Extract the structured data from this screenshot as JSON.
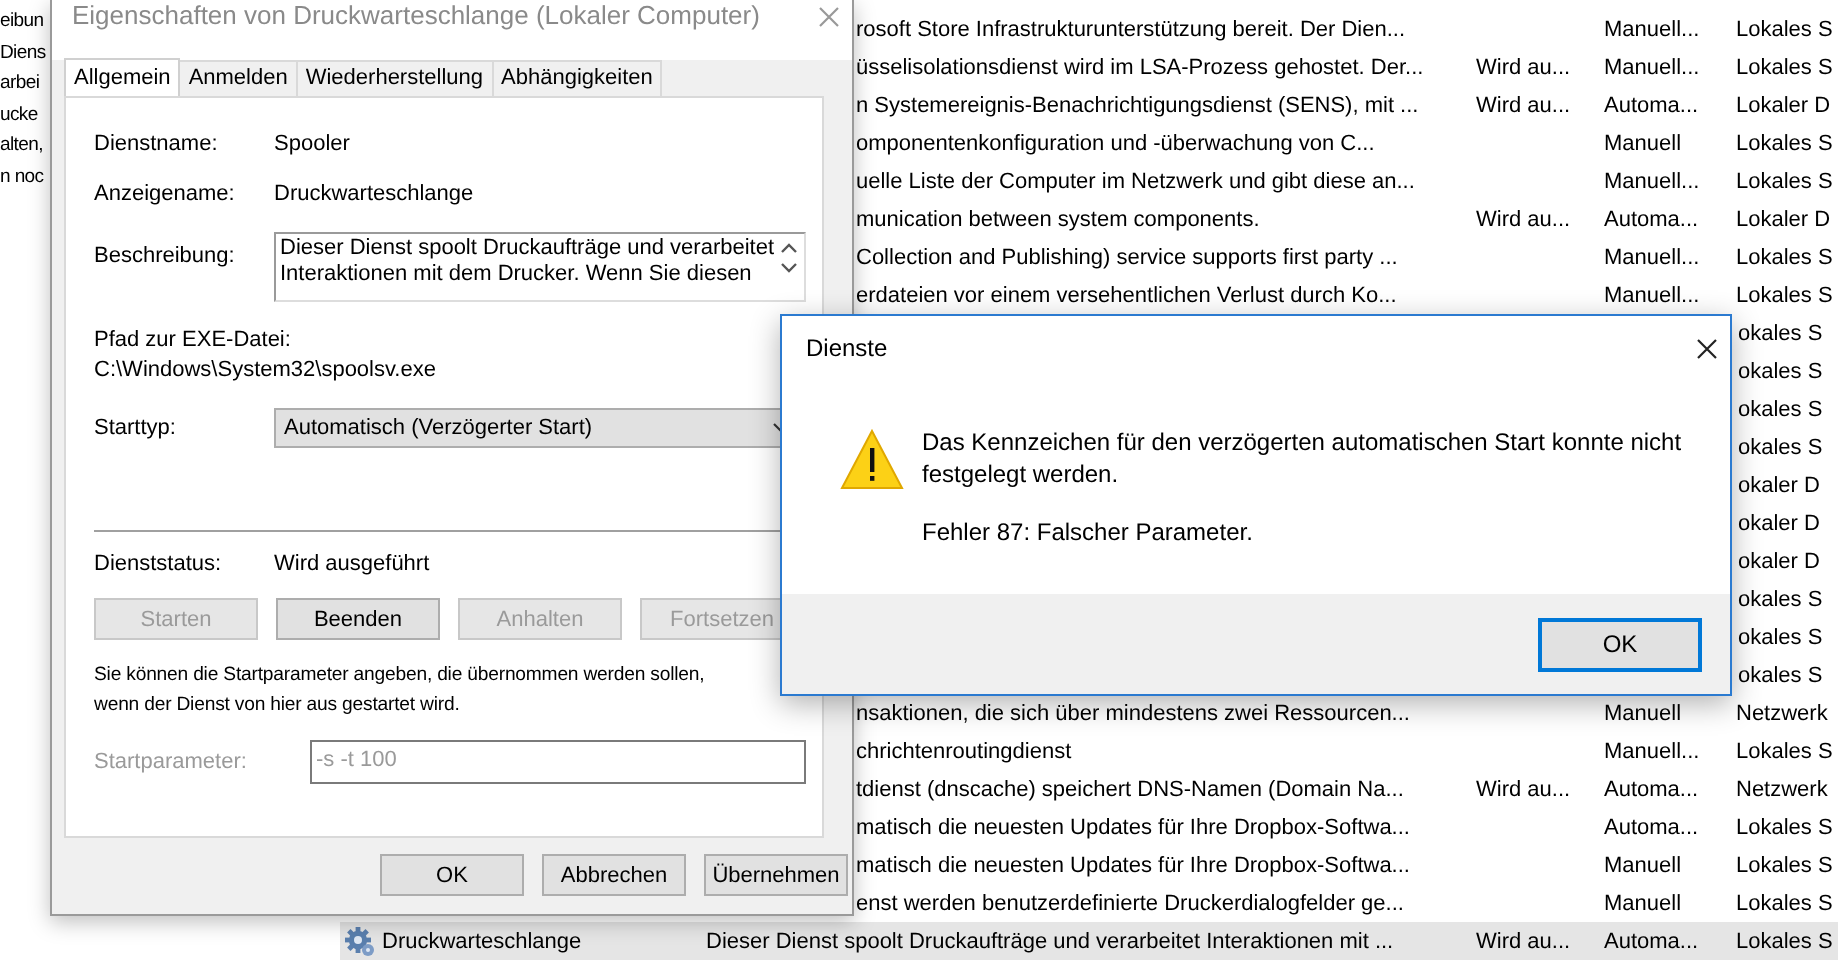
{
  "left_pane_lines": [
    "eibun",
    "Diens",
    "arbei",
    "ucke",
    "alten,",
    "n noc"
  ],
  "services": {
    "rows": [
      {
        "kind": "clipped",
        "selected": false,
        "description": "rosoft Store Infrastrukturunterstützung bereit. Der Dien...",
        "start": "Manuell...",
        "logon": "Lokales S"
      },
      {
        "kind": "clipped",
        "selected": false,
        "description": "üsselisolationsdienst wird im LSA-Prozess gehostet. Der...",
        "status": "Wird au...",
        "start": "Manuell...",
        "logon": "Lokales S"
      },
      {
        "kind": "clipped",
        "selected": false,
        "description": "n Systemereignis-Benachrichtigungsdienst (SENS), mit ...",
        "status": "Wird au...",
        "start": "Automa...",
        "logon": "Lokaler D"
      },
      {
        "kind": "clipped",
        "selected": false,
        "description": "omponentenkonfiguration und -überwachung von C...",
        "start": "Manuell",
        "logon": "Lokales S"
      },
      {
        "kind": "clipped",
        "selected": false,
        "description": "uelle Liste der Computer im Netzwerk und gibt diese an...",
        "start": "Manuell...",
        "logon": "Lokales S"
      },
      {
        "kind": "clipped",
        "selected": false,
        "description": "munication between system components.",
        "status": "Wird au...",
        "start": "Automa...",
        "logon": "Lokaler D"
      },
      {
        "kind": "clipped",
        "selected": false,
        "description": "Collection and Publishing) service supports first party ...",
        "start": "Manuell...",
        "logon": "Lokales S"
      },
      {
        "kind": "clipped",
        "selected": false,
        "description": "erdateien vor einem versehentlichen Verlust durch Ko...",
        "start": "Manuell...",
        "logon": "Lokales S"
      },
      {
        "kind": "covered",
        "selected": false,
        "logon": "okales S"
      },
      {
        "kind": "covered",
        "selected": false,
        "logon": "okales S"
      },
      {
        "kind": "covered",
        "selected": false,
        "logon": "okales S"
      },
      {
        "kind": "covered",
        "selected": false,
        "logon": "okales S"
      },
      {
        "kind": "covered",
        "selected": false,
        "logon": "okaler D"
      },
      {
        "kind": "covered",
        "selected": false,
        "logon": "okaler D"
      },
      {
        "kind": "covered",
        "selected": false,
        "logon": "okaler D"
      },
      {
        "kind": "covered",
        "selected": false,
        "logon": "okales S"
      },
      {
        "kind": "covered",
        "selected": false,
        "logon": "okales S"
      },
      {
        "kind": "covered",
        "selected": false,
        "logon": "okales S"
      },
      {
        "kind": "clipped",
        "selected": false,
        "description": "nsaktionen, die sich über mindestens zwei Ressourcen...",
        "start": "Manuell",
        "logon": "Netzwerk"
      },
      {
        "kind": "clipped",
        "selected": false,
        "description": "chrichtenroutingdienst",
        "start": "Manuell...",
        "logon": "Lokales S"
      },
      {
        "kind": "clipped",
        "selected": false,
        "description": "tdienst (dnscache) speichert DNS-Namen (Domain Na...",
        "status": "Wird au...",
        "start": "Automa...",
        "logon": "Netzwerk"
      },
      {
        "kind": "clipped",
        "selected": false,
        "description": "matisch die neuesten Updates für Ihre Dropbox-Softwa...",
        "start": "Automa...",
        "logon": "Lokales S"
      },
      {
        "kind": "clipped",
        "selected": false,
        "description": "matisch die neuesten Updates für Ihre Dropbox-Softwa...",
        "start": "Manuell",
        "logon": "Lokales S"
      },
      {
        "kind": "clipped",
        "selected": false,
        "description": "enst werden benutzerdefinierte Druckerdialogfelder ge...",
        "start": "Manuell",
        "logon": "Lokales S"
      },
      {
        "kind": "full",
        "selected": true,
        "name": "Druckwarteschlange",
        "description": "Dieser Dienst spoolt Druckaufträge und verarbeitet Interaktionen mit ...",
        "status": "Wird au...",
        "start": "Automa...",
        "logon": "Lokales S"
      }
    ]
  },
  "properties_dialog": {
    "title": "Eigenschaften von Druckwarteschlange (Lokaler Computer)",
    "tabs": [
      {
        "label": "Allgemein",
        "selected": true
      },
      {
        "label": "Anmelden",
        "selected": false
      },
      {
        "label": "Wiederherstellung",
        "selected": false
      },
      {
        "label": "Abhängigkeiten",
        "selected": false
      }
    ],
    "fields": [
      {
        "label": "Dienstname:",
        "value": "Spooler"
      },
      {
        "label": "Anzeigename:",
        "value": "Druckwarteschlange"
      }
    ],
    "description": {
      "label": "Beschreibung:",
      "value": "Dieser Dienst spoolt Druckaufträge und verarbeitet\nInteraktionen mit dem Drucker. Wenn Sie diesen"
    },
    "exe_path": {
      "label": "Pfad zur EXE-Datei:",
      "value": "C:\\Windows\\System32\\spoolsv.exe"
    },
    "startup_type": {
      "label": "Starttyp:",
      "value": "Automatisch (Verzögerter Start)"
    },
    "service_status": {
      "label": "Dienststatus:",
      "value": "Wird ausgeführt"
    },
    "control_buttons": [
      {
        "label": "Starten",
        "disabled": true
      },
      {
        "label": "Beenden",
        "disabled": false
      },
      {
        "label": "Anhalten",
        "disabled": true
      },
      {
        "label": "Fortsetzen",
        "disabled": true
      }
    ],
    "hint": "Sie können die Startparameter angeben, die übernommen werden sollen,\nwenn der Dienst von hier aus gestartet wird.",
    "start_parameters": {
      "label": "Startparameter:",
      "value": "-s -t 100",
      "disabled": true
    },
    "buttons": [
      {
        "label": "OK"
      },
      {
        "label": "Abbrechen"
      },
      {
        "label": "Übernehmen"
      }
    ]
  },
  "message_box": {
    "title": "Dienste",
    "message": "Das Kennzeichen für den verzögerten automatischen Start konnte nicht\nfestgelegt werden.",
    "error": "Fehler 87: Falscher Parameter.",
    "buttons": [
      {
        "label": "OK",
        "default": true
      }
    ]
  }
}
